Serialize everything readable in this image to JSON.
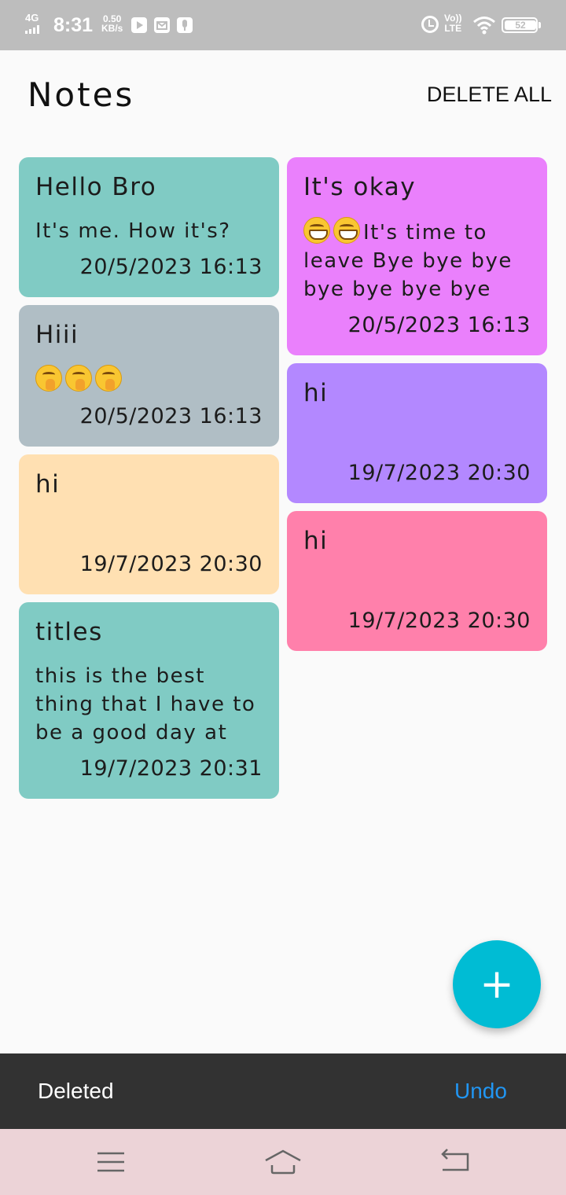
{
  "status_bar": {
    "network": "4G",
    "time": "8:31",
    "speed_value": "0.50",
    "speed_unit": "KB/s",
    "volte_top": "Vo))",
    "volte_bottom": "LTE",
    "battery": "52",
    "icons": [
      "youtube-icon",
      "mail-icon",
      "mic-icon",
      "alarm-icon",
      "wifi-icon",
      "battery-icon"
    ]
  },
  "app_bar": {
    "title": "Notes",
    "delete_all": "DELETE ALL"
  },
  "notes_left": [
    {
      "title": "Hello Bro",
      "body": "It's me.  How it's?",
      "date": "20/5/2023 16:13",
      "color": "#80cbc4"
    },
    {
      "title": "Hiii",
      "emoji_count": 3,
      "emoji": "shushing-face",
      "date": "20/5/2023 16:13",
      "color": "#b0bec5"
    },
    {
      "title": "hi",
      "body": "",
      "date": "19/7/2023 20:30",
      "color": "#ffe0b2"
    },
    {
      "title": "titles",
      "body": "this is the best thing that I have to be a good day at",
      "date": "19/7/2023 20:31",
      "color": "#80cbc4"
    }
  ],
  "notes_right": [
    {
      "title": "It's okay",
      "body": "It's time to leave Bye bye bye bye bye bye bye",
      "emoji_count": 2,
      "emoji": "grinning-face",
      "date": "20/5/2023 16:13",
      "color": "#ea80fc"
    },
    {
      "title": "hi",
      "body": "",
      "date": "19/7/2023 20:30",
      "color": "#b388ff"
    },
    {
      "title": "hi",
      "body": "",
      "date": "19/7/2023 20:30",
      "color": "#ff80ab"
    }
  ],
  "fab": {
    "label": "+",
    "color": "#00bcd4"
  },
  "snackbar": {
    "message": "Deleted",
    "action": "Undo",
    "action_color": "#2196f3"
  },
  "nav_bar": {
    "icons": [
      "menu-icon",
      "home-icon",
      "back-icon"
    ]
  }
}
